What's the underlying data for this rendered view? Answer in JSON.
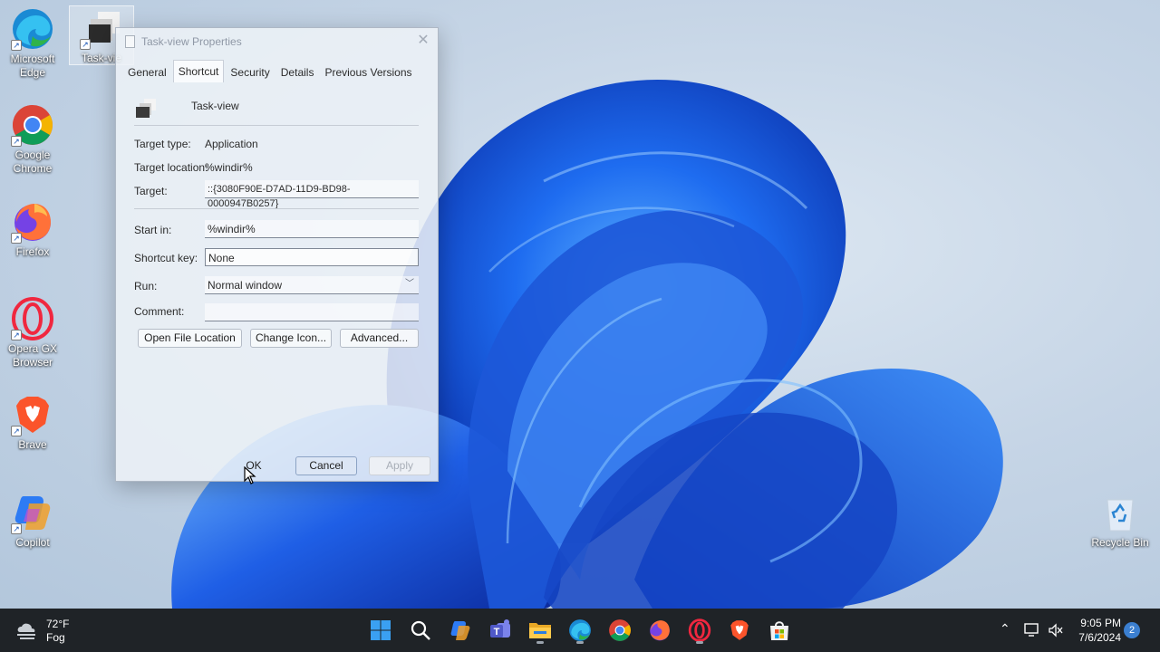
{
  "desktop": {
    "icons": [
      {
        "label": "Microsoft Edge",
        "icon": "edge-icon"
      },
      {
        "label": "Task-view",
        "icon": "task-view-icon"
      },
      {
        "label": "Google Chrome",
        "icon": "chrome-icon"
      },
      {
        "label": "Firefox",
        "icon": "firefox-icon"
      },
      {
        "label": "Opera GX Browser",
        "icon": "opera-gx-icon"
      },
      {
        "label": "Brave",
        "icon": "brave-icon"
      },
      {
        "label": "Copilot",
        "icon": "copilot-icon"
      },
      {
        "label": "Recycle Bin",
        "icon": "recycle-bin-icon"
      }
    ],
    "icon_labels": {
      "edge_1": "Microsoft",
      "edge_2": "Edge",
      "task_view": "Task-vie",
      "chrome_1": "Google",
      "chrome_2": "Chrome",
      "firefox": "Firefox",
      "opera_1": "Opera GX",
      "opera_2": "Browser",
      "brave": "Brave",
      "copilot": "Copilot",
      "recycle": "Recycle Bin"
    }
  },
  "dialog": {
    "title": "Task-view Properties",
    "tabs": [
      "General",
      "Shortcut",
      "Security",
      "Details",
      "Previous Versions"
    ],
    "active_tab": "Shortcut",
    "name": "Task-view",
    "target_type_label": "Target type:",
    "target_type": "Application",
    "target_location_label": "Target location:",
    "target_location": "%windir%",
    "target_label": "Target:",
    "target": "::{3080F90E-D7AD-11D9-BD98-0000947B0257}",
    "start_in_label": "Start in:",
    "start_in": "%windir%",
    "shortcut_key_label": "Shortcut key:",
    "shortcut_key": "None",
    "run_label": "Run:",
    "run": "Normal window",
    "comment_label": "Comment:",
    "comment": "",
    "buttons": {
      "open_file_location": "Open File Location",
      "change_icon": "Change Icon...",
      "advanced": "Advanced...",
      "ok": "OK",
      "cancel": "Cancel",
      "apply": "Apply"
    }
  },
  "taskbar": {
    "weather_temp": "72°F",
    "weather_cond": "Fog",
    "apps": [
      "start-icon",
      "search-icon",
      "copilot-icon",
      "teams-icon",
      "file-explorer-icon",
      "edge-icon",
      "chrome-icon",
      "firefox-icon",
      "opera-gx-icon",
      "brave-icon",
      "microsoft-store-icon"
    ],
    "time": "9:05 PM",
    "date": "7/6/2024",
    "notifications": "2"
  },
  "colors": {
    "taskbar_bg": "#1f2327",
    "accent": "#3b7fd0",
    "bloom_blue": "#1e5fe0"
  }
}
